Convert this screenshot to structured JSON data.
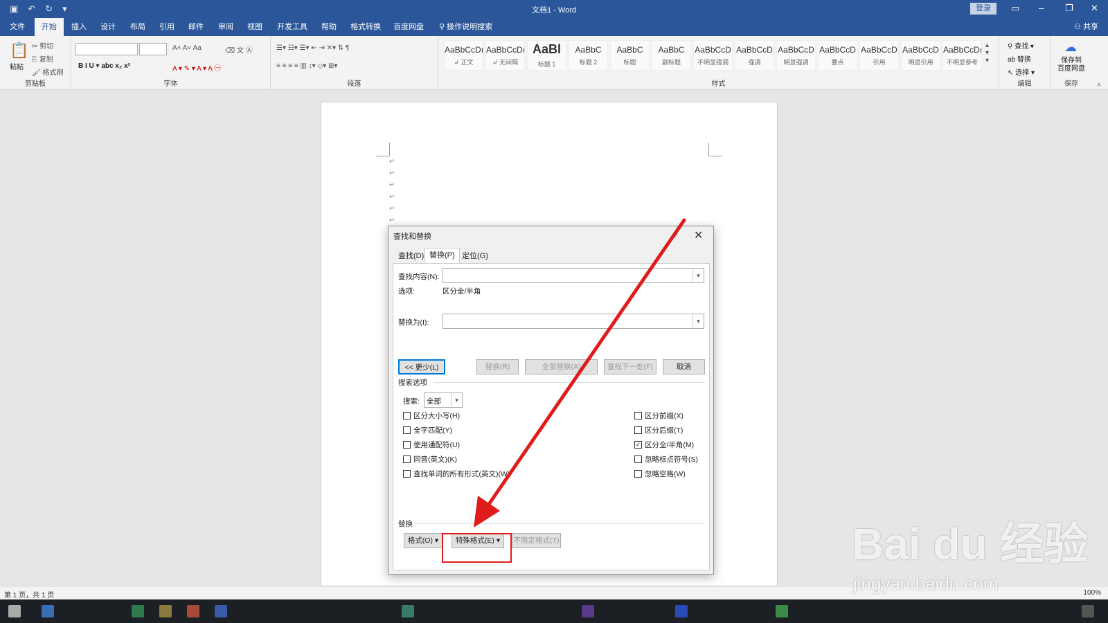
{
  "app": {
    "doc_title": "文档1  -  Word",
    "login": "登录",
    "share": "共享",
    "tabs": [
      "文件",
      "开始",
      "插入",
      "设计",
      "布局",
      "引用",
      "邮件",
      "审阅",
      "视图",
      "开发工具",
      "帮助",
      "格式转换",
      "百度网盘"
    ],
    "tell_me": "操作说明搜索"
  },
  "ribbon": {
    "clipboard": {
      "paste": "粘贴",
      "cut": "剪切",
      "copy": "复制",
      "painter": "格式刷",
      "label": "剪贴板"
    },
    "font_label": "字体",
    "para_label": "段落",
    "styles_label": "样式",
    "styles": [
      {
        "prev": "AaBbCcDı",
        "name": "↲ 正文"
      },
      {
        "prev": "AaBbCcDı",
        "name": "↲ 无间隔"
      },
      {
        "prev": "AaBl",
        "name": "标题 1",
        "big": true
      },
      {
        "prev": "AaBbC",
        "name": "标题 2"
      },
      {
        "prev": "AaBbC",
        "name": "标题"
      },
      {
        "prev": "AaBbC",
        "name": "副标题"
      },
      {
        "prev": "AaBbCcD",
        "name": "不明显强调"
      },
      {
        "prev": "AaBbCcD",
        "name": "强调"
      },
      {
        "prev": "AaBbCcD",
        "name": "明显强调"
      },
      {
        "prev": "AaBbCcD",
        "name": "要点"
      },
      {
        "prev": "AaBbCcD",
        "name": "引用"
      },
      {
        "prev": "AaBbCcD",
        "name": "明显引用"
      },
      {
        "prev": "AaBbCcDı",
        "name": "不明显参考"
      }
    ],
    "edit": {
      "find": "查找",
      "replace": "替换",
      "select": "选择",
      "label": "编辑"
    },
    "save": {
      "btn": "保存到\n百度网盘",
      "label": "保存"
    }
  },
  "status": {
    "left": "第 1 页，共 1 页",
    "zoom": "100%"
  },
  "dialog": {
    "title": "查找和替换",
    "help": "?",
    "tabs": [
      "查找(D)",
      "替换(P)",
      "定位(G)"
    ],
    "find_label": "查找内容(N):",
    "options_label": "选项:",
    "options_value": "区分全/半角",
    "replace_label": "替换为(I):",
    "buttons": {
      "less": "<< 更少(L)",
      "replace": "替换(R)",
      "replace_all": "全部替换(A)",
      "find_next": "查找下一处(F)",
      "cancel": "取消"
    },
    "search_options": "搜索选项",
    "search_label": "搜索:",
    "search_value": "全部",
    "left_checks": [
      {
        "label": "区分大小写(H)",
        "checked": false
      },
      {
        "label": "全字匹配(Y)",
        "checked": false
      },
      {
        "label": "使用通配符(U)",
        "checked": false
      },
      {
        "label": "同音(英文)(K)",
        "checked": false
      },
      {
        "label": "查找单词的所有形式(英文)(W)",
        "checked": false
      }
    ],
    "right_checks": [
      {
        "label": "区分前缀(X)",
        "checked": false
      },
      {
        "label": "区分后缀(T)",
        "checked": false
      },
      {
        "label": "区分全/半角(M)",
        "checked": true
      },
      {
        "label": "忽略标点符号(S)",
        "checked": false
      },
      {
        "label": "忽略空格(W)",
        "checked": false
      }
    ],
    "replace_section": "替换",
    "format_btn": "格式(O) ▾",
    "special_btn": "特殊格式(E) ▾",
    "noformat_btn": "不限定格式(T)"
  },
  "watermark": {
    "main": "Bai du 经验",
    "sub": "jingyan.baidu.com"
  },
  "colors": {
    "accent": "#2b579a",
    "highlight": "#e01b1b"
  }
}
